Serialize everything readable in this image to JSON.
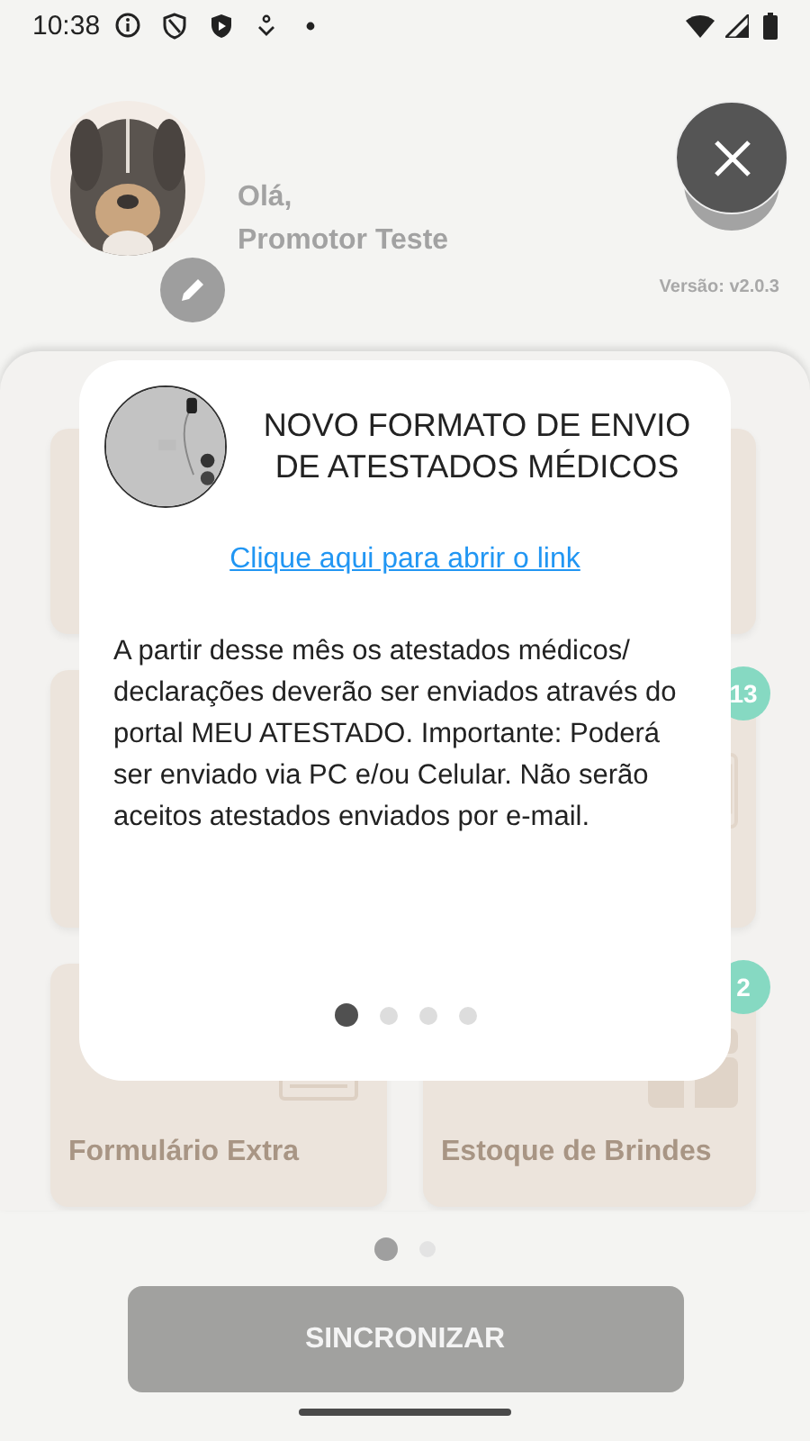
{
  "status_bar": {
    "time": "10:38"
  },
  "header": {
    "greeting": "Olá,",
    "user_name": "Promotor Teste",
    "version": "Versão: v2.0.3"
  },
  "cards": [
    {
      "kind": "blank"
    },
    {
      "kind": "blank"
    },
    {
      "kind": "blank"
    },
    {
      "kind": "phone",
      "badge": "13"
    },
    {
      "kind": "form",
      "label": "Formulário Extra"
    },
    {
      "kind": "gift",
      "label": "Estoque de Brindes",
      "badge": "2"
    }
  ],
  "pager": [
    {
      "selected": true
    },
    {
      "selected": false
    }
  ],
  "sync_button": "SINCRONIZAR",
  "modal": {
    "title": "NOVO FORMATO DE ENVIO DE ATESTADOS MÉDICOS",
    "link": "Clique aqui para abrir o link",
    "body": "A partir desse mês os atestados médicos/ declarações deverão ser enviados através do portal MEU ATESTADO. Importante: Poderá ser enviado via PC e/ou Celular. Não serão aceitos atestados enviados por e-mail.",
    "pages": [
      {
        "selected": true
      },
      {
        "selected": false
      },
      {
        "selected": false
      },
      {
        "selected": false
      }
    ]
  }
}
